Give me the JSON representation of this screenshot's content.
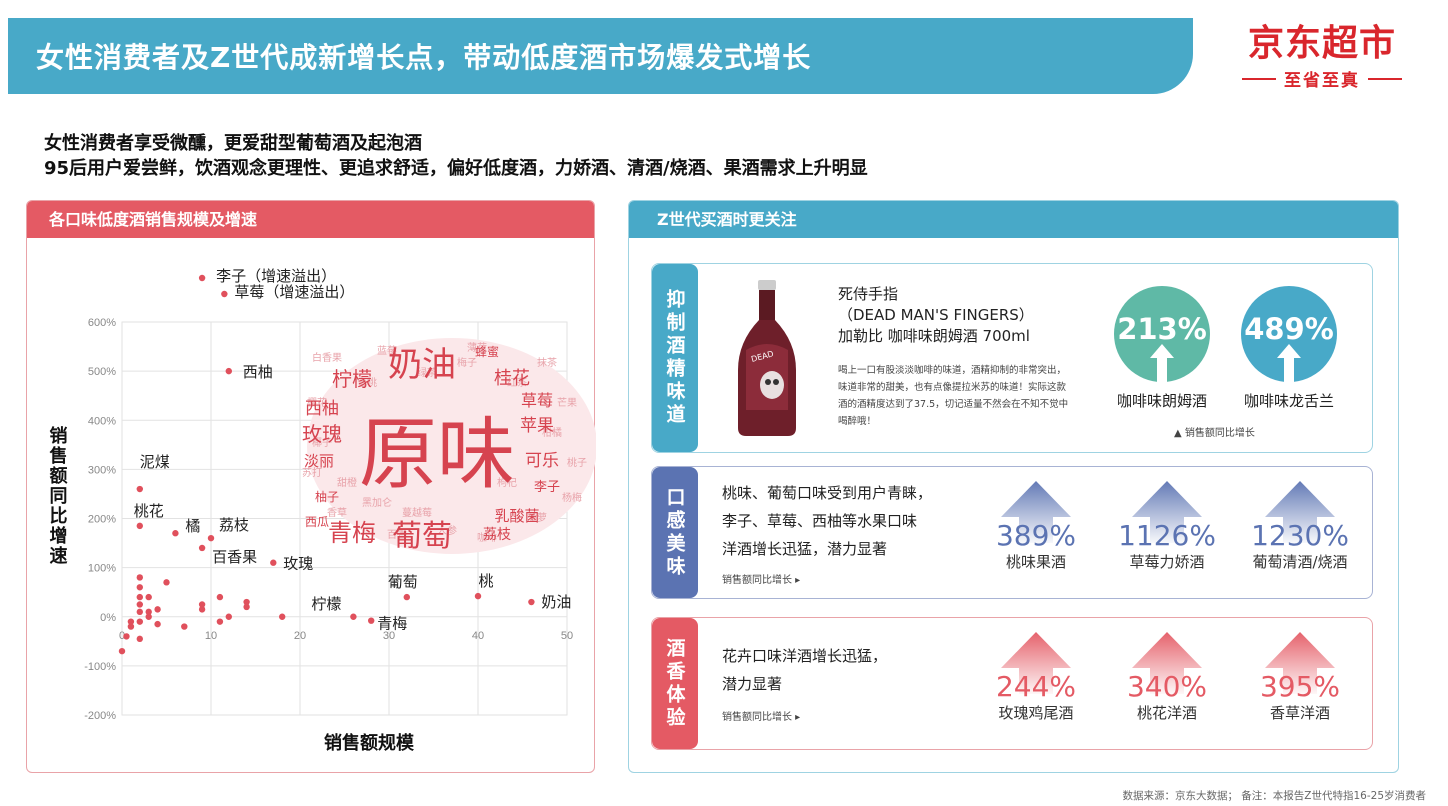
{
  "header": {
    "title": "女性消费者及Z世代成新增长点，带动低度酒市场爆发式增长",
    "brand": "京东超市",
    "slogan": "至省至真"
  },
  "subtitle": {
    "line1": "女性消费者享受微醺，更爱甜型葡萄酒及起泡酒",
    "line2": "95后用户爱尝鲜，饮酒观念更理性、更追求舒适，偏好低度酒，力娇酒、清酒/烧酒、果酒需求上升明显"
  },
  "left_panel": {
    "title": "各口味低度酒销售规模及增速"
  },
  "chart_data": {
    "type": "scatter",
    "title": "",
    "xlabel": "销售额规模",
    "ylabel": "销售额同比增速",
    "xlim": [
      0,
      50
    ],
    "ylim": [
      -200,
      600
    ],
    "x_ticks": [
      0,
      10,
      20,
      30,
      40,
      50
    ],
    "y_ticks": [
      "-200%",
      "-100%",
      "0%",
      "100%",
      "200%",
      "300%",
      "400%",
      "500%",
      "600%"
    ],
    "y_tick_values": [
      -200,
      -100,
      0,
      100,
      200,
      300,
      400,
      500,
      600
    ],
    "grid": true,
    "labeled_points": [
      {
        "label": "李子（增速溢出）",
        "x": 9,
        "y": 675
      },
      {
        "label": "草莓（增速溢出）",
        "x": 11.5,
        "y": 645
      },
      {
        "label": "西柚",
        "x": 12,
        "y": 500
      },
      {
        "label": "泥煤",
        "x": 2,
        "y": 260
      },
      {
        "label": "桃花",
        "x": 2,
        "y": 185
      },
      {
        "label": "橘",
        "x": 6,
        "y": 170
      },
      {
        "label": "荔枝",
        "x": 10,
        "y": 160
      },
      {
        "label": "百香果",
        "x": 9,
        "y": 140
      },
      {
        "label": "玫瑰",
        "x": 17,
        "y": 110
      },
      {
        "label": "葡萄",
        "x": 32,
        "y": 40
      },
      {
        "label": "桃",
        "x": 40,
        "y": 42
      },
      {
        "label": "奶油",
        "x": 46,
        "y": 30
      },
      {
        "label": "柠檬",
        "x": 26,
        "y": 0
      },
      {
        "label": "青梅",
        "x": 28,
        "y": -8
      }
    ],
    "points": [
      {
        "x": 0,
        "y": -70
      },
      {
        "x": 0.5,
        "y": -40
      },
      {
        "x": 1,
        "y": -20
      },
      {
        "x": 1,
        "y": -10
      },
      {
        "x": 2,
        "y": -45
      },
      {
        "x": 2,
        "y": -10
      },
      {
        "x": 2,
        "y": 10
      },
      {
        "x": 2,
        "y": 25
      },
      {
        "x": 2,
        "y": 40
      },
      {
        "x": 2,
        "y": 60
      },
      {
        "x": 2,
        "y": 80
      },
      {
        "x": 3,
        "y": 0
      },
      {
        "x": 3,
        "y": 10
      },
      {
        "x": 3,
        "y": 40
      },
      {
        "x": 4,
        "y": -15
      },
      {
        "x": 4,
        "y": 15
      },
      {
        "x": 5,
        "y": 70
      },
      {
        "x": 7,
        "y": -20
      },
      {
        "x": 9,
        "y": 15
      },
      {
        "x": 9,
        "y": 25
      },
      {
        "x": 11,
        "y": -10
      },
      {
        "x": 11,
        "y": 40
      },
      {
        "x": 12,
        "y": 0
      },
      {
        "x": 14,
        "y": 20
      },
      {
        "x": 14,
        "y": 30
      },
      {
        "x": 18,
        "y": 0
      }
    ],
    "wordcloud": {
      "main": "原味",
      "big": [
        "奶油",
        "葡萄",
        "青梅",
        "柠檬",
        "桂花",
        "玫瑰",
        "西柚",
        "苹果",
        "草莓",
        "可乐",
        "乳酸菌",
        "淡丽",
        "荔枝",
        "李子",
        "蜂蜜",
        "柚子",
        "西瓜"
      ],
      "small": [
        "白香果",
        "蓝莓",
        "薄荷",
        "抹茶",
        "樱花",
        "芒果",
        "苏打",
        "桃子",
        "香草",
        "菠萝",
        "百香",
        "咖啡",
        "蜜桃",
        "红茶",
        "绿茶",
        "杨梅",
        "椰子",
        "人参",
        "枸杞",
        "黑加仑",
        "柑橘",
        "甜橙",
        "梅子",
        "蔓越莓"
      ]
    }
  },
  "right_panel": {
    "title": "Z世代买酒时更关注",
    "card1": {
      "tag": "抑制酒精味道",
      "product_lines": [
        "死侍手指",
        "（DEAD MAN'S FINGERS）",
        "加勒比 咖啡味朗姆酒 700ml"
      ],
      "description": "喝上一口有股淡淡咖啡的味道，酒精抑制的非常突出，味道非常的甜美，也有点像提拉米苏的味道！实际这款酒的酒精度达到了37.5，切记适量不然会在不知不觉中喝醉哦！",
      "metrics": [
        {
          "value": "213%",
          "label": "咖啡味朗姆酒",
          "color": "#5fb9a6"
        },
        {
          "value": "489%",
          "label": "咖啡味龙舌兰",
          "color": "#48a9c8"
        }
      ],
      "note": "▲ 销售额同比增长"
    },
    "card2": {
      "tag": "口感美味",
      "text": [
        "桃味、葡萄口味受到用户青睐，",
        "李子、草莓、西柚等水果口味",
        "洋酒增长迅猛，潜力显著"
      ],
      "note": "销售额同比增长 ▸",
      "color": "#5b73b2",
      "metrics": [
        {
          "value": "389%",
          "label": "桃味果酒"
        },
        {
          "value": "1126%",
          "label": "草莓力娇酒"
        },
        {
          "value": "1230%",
          "label": "葡萄清酒/烧酒"
        }
      ]
    },
    "card3": {
      "tag": "酒香体验",
      "text": [
        "花卉口味洋酒增长迅猛，",
        "潜力显著"
      ],
      "note": "销售额同比增长 ▸",
      "color": "#e45a64",
      "metrics": [
        {
          "value": "244%",
          "label": "玫瑰鸡尾酒"
        },
        {
          "value": "340%",
          "label": "桃花洋酒"
        },
        {
          "value": "395%",
          "label": "香草洋酒"
        }
      ]
    }
  },
  "footer": {
    "source": "数据来源：京东大数据； 备注：本报告Z世代特指16-25岁消费者"
  }
}
